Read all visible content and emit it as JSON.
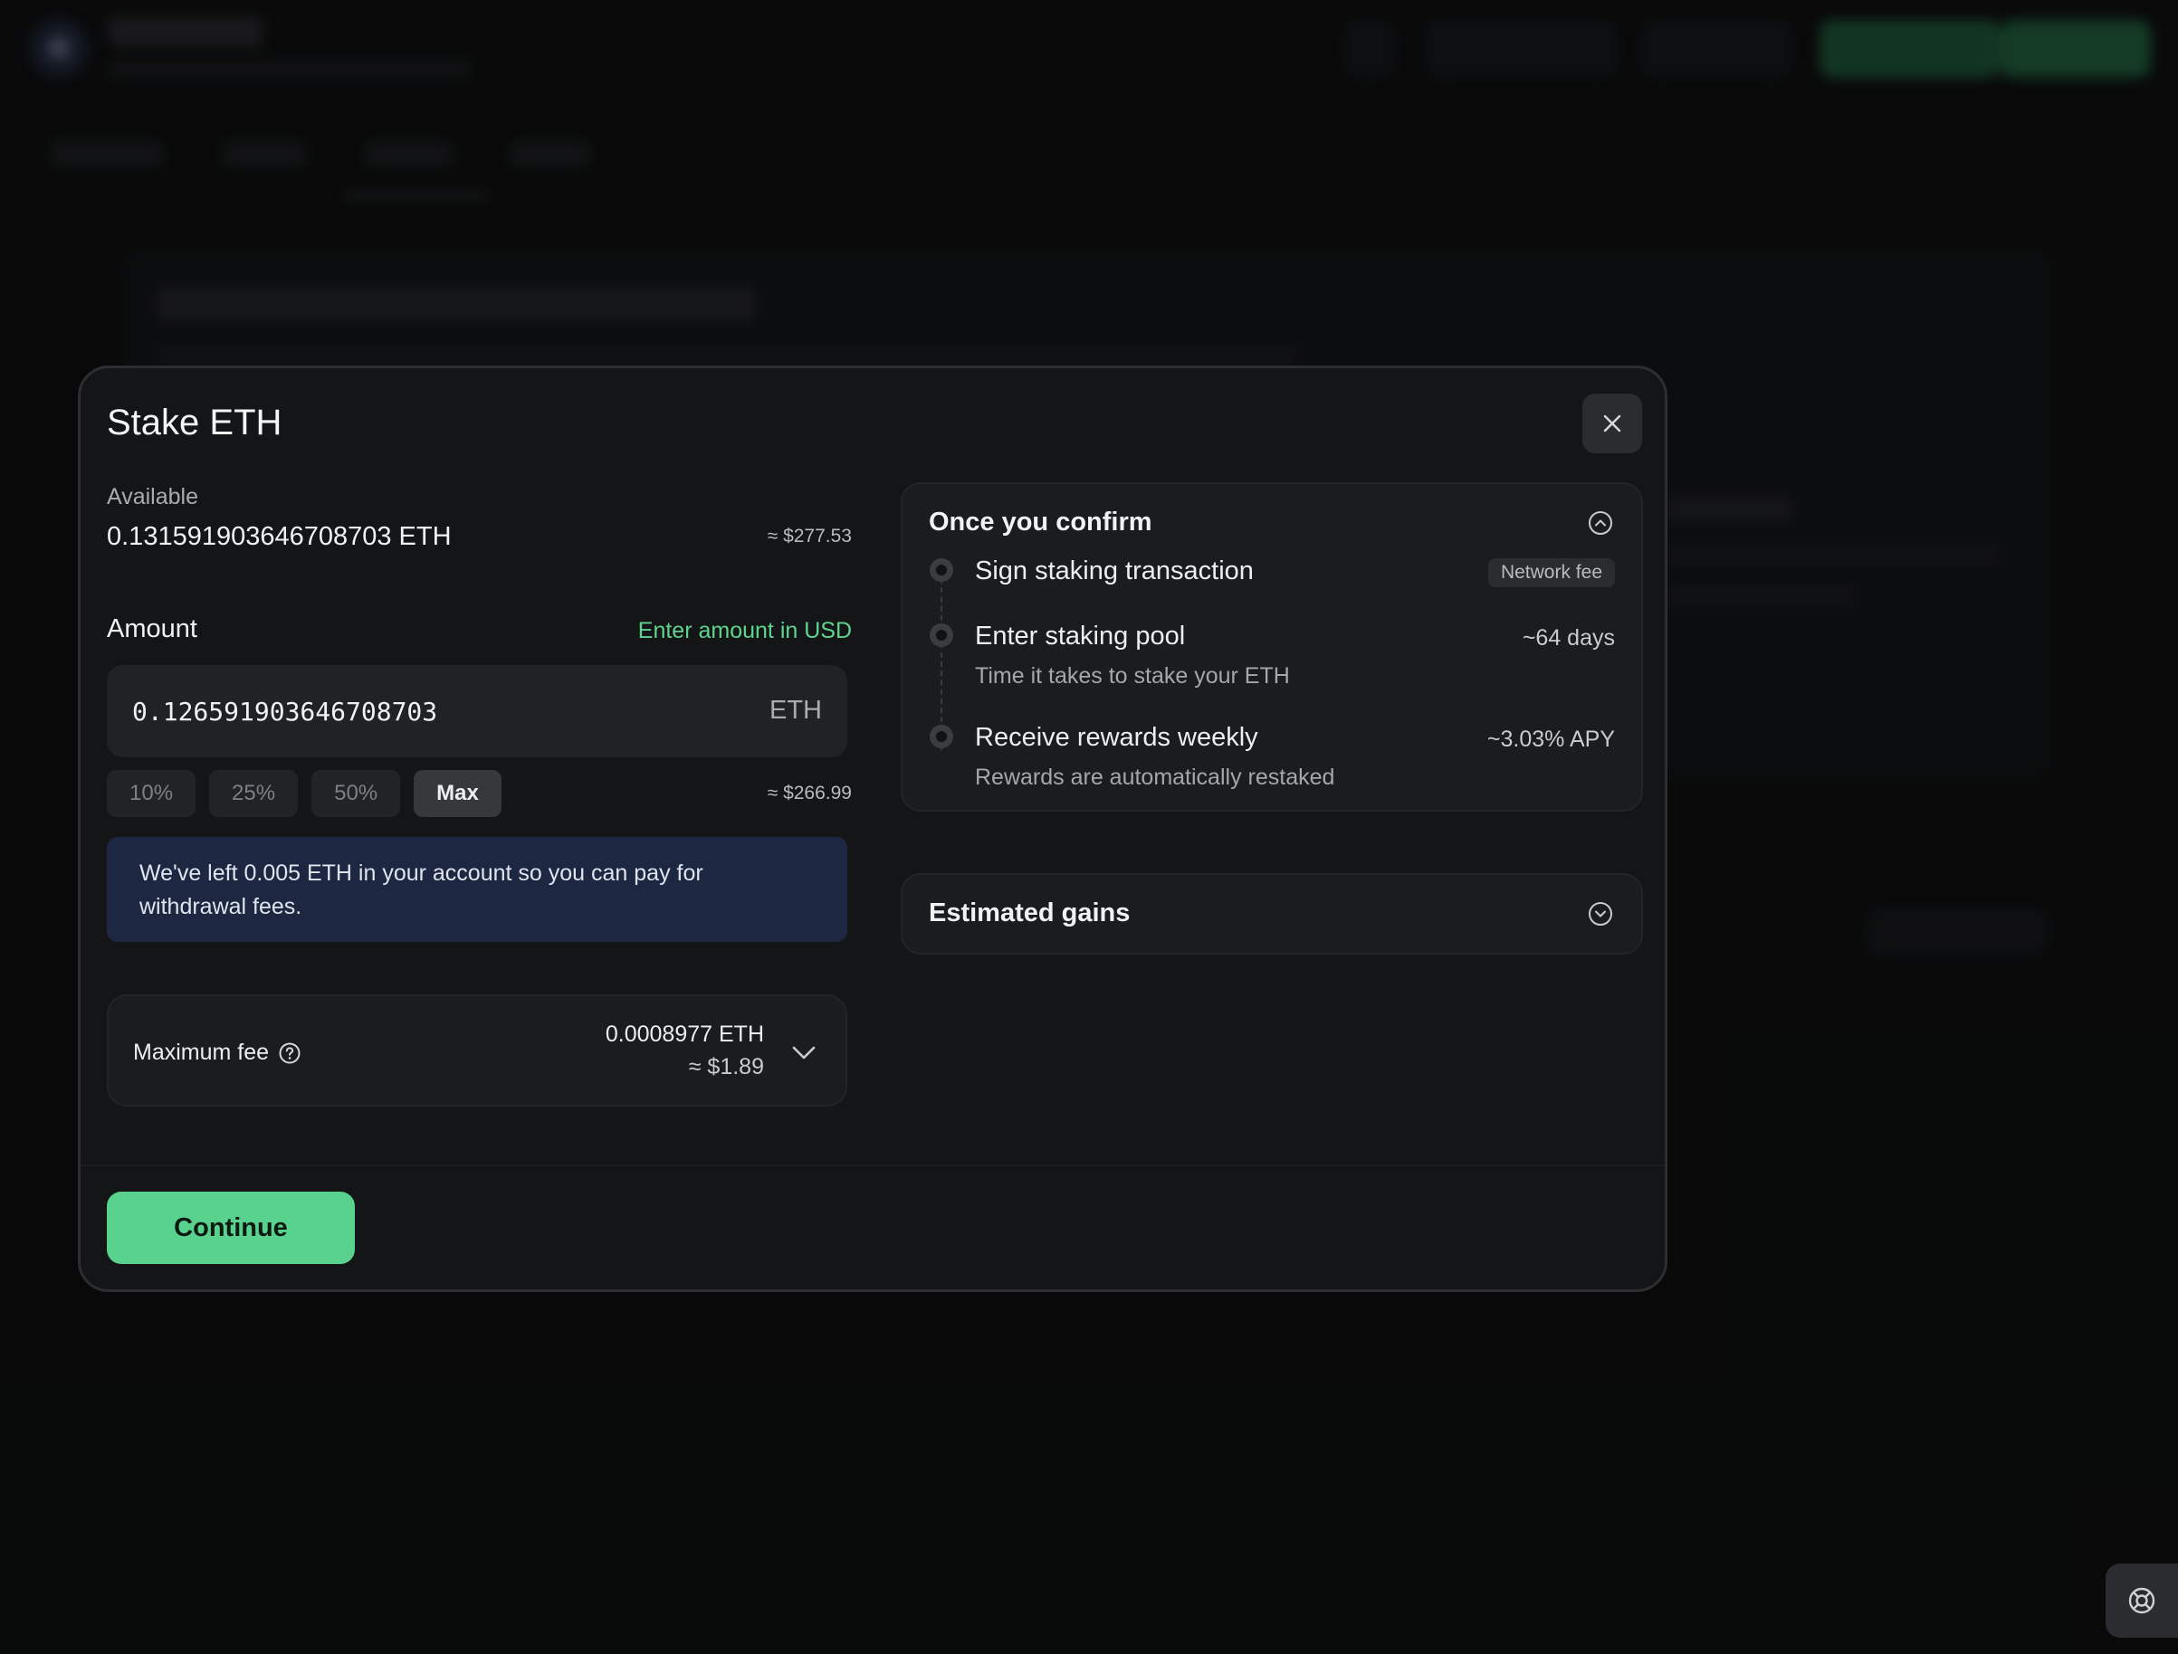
{
  "modal": {
    "title": "Stake ETH",
    "available": {
      "label": "Available",
      "value": "0.131591903646708703 ETH",
      "usd": "≈ $277.53"
    },
    "amount": {
      "label": "Amount",
      "usd_toggle": "Enter amount in USD",
      "value": "0.126591903646708703",
      "unit": "ETH",
      "usd": "≈ $266.99",
      "presets": [
        "10%",
        "25%",
        "50%",
        "Max"
      ],
      "active_preset": "Max"
    },
    "notice": "We've left 0.005 ETH in your account so you can pay for withdrawal fees.",
    "fee": {
      "label": "Maximum fee",
      "eth": "0.0008977 ETH",
      "usd": "≈ $1.89"
    },
    "continue_label": "Continue"
  },
  "confirm": {
    "title": "Once you confirm",
    "steps": [
      {
        "title": "Sign staking transaction",
        "badge": "Network fee"
      },
      {
        "title": "Enter staking pool",
        "right": "~64 days",
        "sub": "Time it takes to stake your ETH"
      },
      {
        "title": "Receive rewards weekly",
        "right": "~3.03% APY",
        "sub": "Rewards are automatically restaked"
      }
    ]
  },
  "gains": {
    "title": "Estimated gains"
  },
  "colors": {
    "accent": "#58d28c",
    "link": "#5fd48f",
    "notice_bg": "#1d2742",
    "modal_bg": "#141517"
  },
  "icons": [
    "close-icon",
    "question-circle-icon",
    "chevron-down-icon",
    "chevron-up-circle-icon",
    "chevron-down-circle-icon",
    "lifebuoy-icon"
  ]
}
